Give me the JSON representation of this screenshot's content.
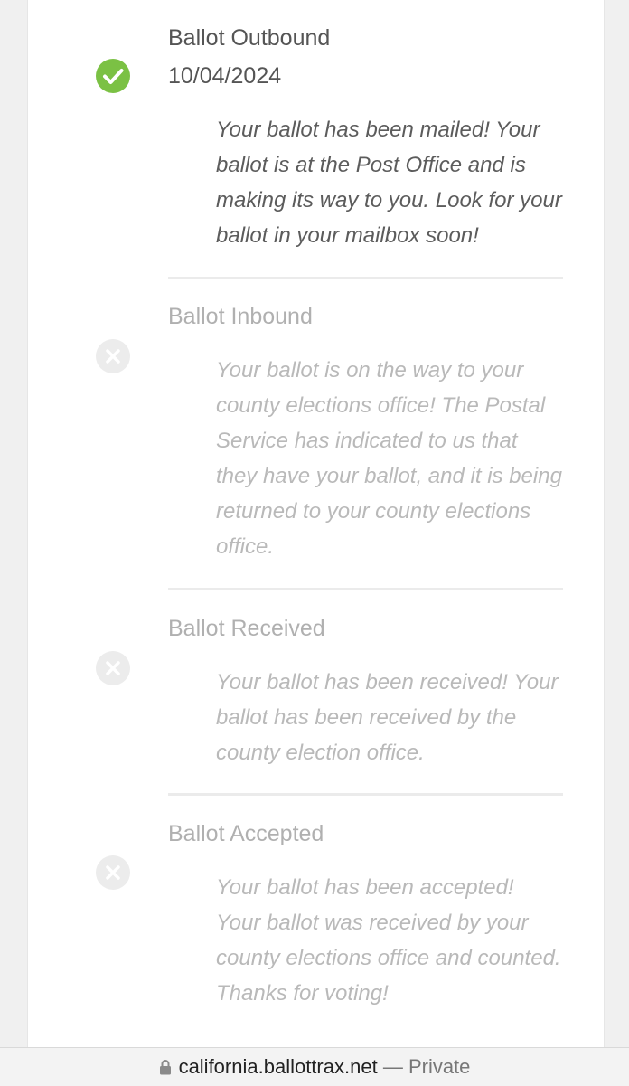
{
  "steps": [
    {
      "title": "Ballot Outbound",
      "date": "10/04/2024",
      "status": "complete",
      "icon": "check-circle-icon",
      "color": "#7bc144",
      "description": "Your ballot has been mailed! Your ballot is at the Post Office and is making its way to you. Look for your ballot in your mailbox soon!"
    },
    {
      "title": "Ballot Inbound",
      "status": "incomplete",
      "icon": "x-circle-icon",
      "color": "#ececec",
      "description": "Your ballot is on the way to your county elections office! The Postal Service has indicated to us that they have your ballot, and it is being returned to your county elections office."
    },
    {
      "title": "Ballot Received",
      "status": "incomplete",
      "icon": "x-circle-icon",
      "color": "#ececec",
      "description": "Your ballot has been received! Your ballot has been received by the county election office."
    },
    {
      "title": "Ballot Accepted",
      "status": "incomplete",
      "icon": "x-circle-icon",
      "color": "#ececec",
      "description": "Your ballot has been accepted! Your ballot was received by your county elections office and counted. Thanks for voting!"
    }
  ],
  "browser": {
    "lock_icon": "lock-icon",
    "host": "california.ballottrax.net",
    "separator": "—",
    "privacy": "Private"
  }
}
